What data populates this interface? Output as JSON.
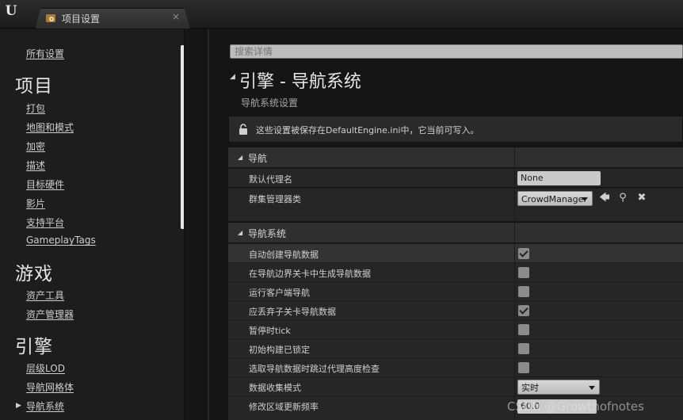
{
  "window": {
    "tab_title": "项目设置",
    "tab_close": "×"
  },
  "sidebar": {
    "all_settings": "所有设置",
    "sections": [
      {
        "heading": "项目",
        "items": [
          "打包",
          "地图和模式",
          "加密",
          "描述",
          "目标硬件",
          "影片",
          "支持平台",
          "GameplayTags"
        ]
      },
      {
        "heading": "游戏",
        "items": [
          "资产工具",
          "资产管理器"
        ]
      },
      {
        "heading": "引擎",
        "items": [
          "层级LOD",
          "导航网格体",
          "导航系统"
        ]
      }
    ],
    "selected_marker": "▶"
  },
  "main": {
    "search_placeholder": "搜索详情",
    "title": "引擎 - 导航系统",
    "subtitle": "导航系统设置",
    "notice": "这些设置被保存在DefaultEngine.ini中，它当前可写入。",
    "categories": [
      {
        "label": "导航",
        "rows": [
          {
            "label": "默认代理名",
            "textbox": "None"
          },
          {
            "label": "群集管理器类",
            "combo": "CrowdManager"
          }
        ]
      },
      {
        "label": "导航系统",
        "rows": [
          {
            "label": "自动创建导航数据",
            "checked": true
          },
          {
            "label": "在导航边界关卡中生成导航数据",
            "checked": false
          },
          {
            "label": "运行客户端导航",
            "checked": false
          },
          {
            "label": "应丢弃子关卡导航数据",
            "checked": true
          },
          {
            "label": "暂停时tick",
            "checked": false
          },
          {
            "label": "初始构建已锁定",
            "checked": false
          },
          {
            "label": "选取导航数据时跳过代理高度检查",
            "checked": false
          },
          {
            "label": "数据收集模式",
            "combo": "实时"
          },
          {
            "label": "修改区域更新频率",
            "textbox": "60.0"
          }
        ]
      }
    ]
  },
  "watermark": "CSDN @Growthofnotes",
  "icons": {
    "logo": "unreal-logo-icon",
    "tab": "settings-icon",
    "lock": "lock-icon",
    "use": "arrow-left-icon",
    "browse": "search-icon",
    "clear": "close-icon"
  }
}
